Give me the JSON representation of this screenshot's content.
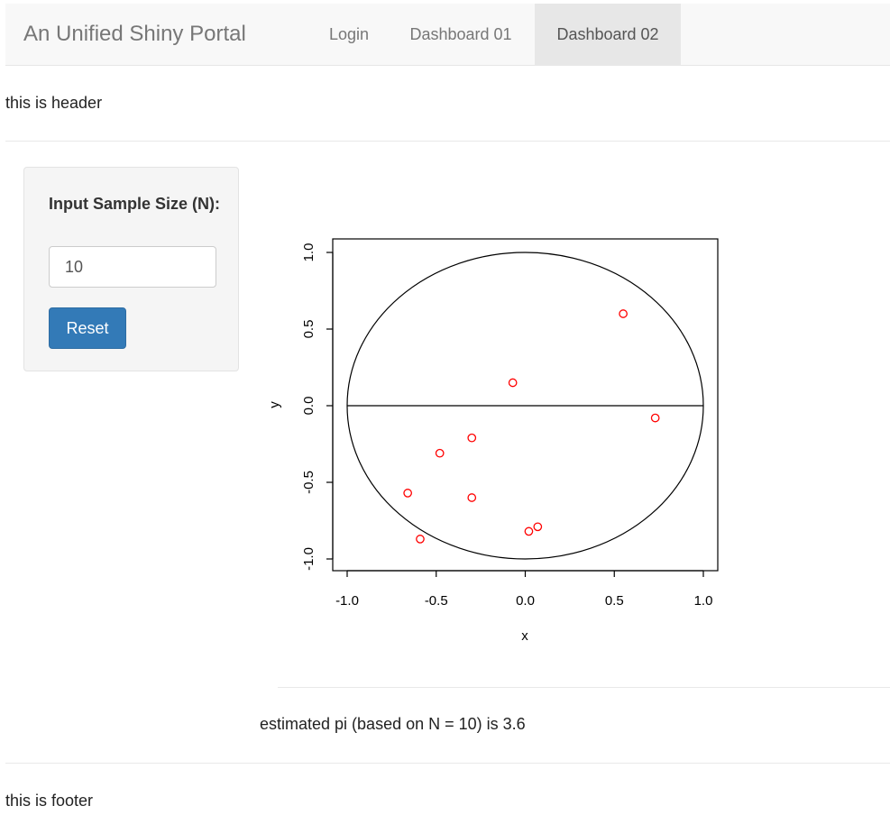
{
  "navbar": {
    "brand": "An Unified Shiny Portal",
    "items": [
      {
        "label": "Login",
        "active": false
      },
      {
        "label": "Dashboard 01",
        "active": false
      },
      {
        "label": "Dashboard 02",
        "active": true
      }
    ]
  },
  "header": {
    "text": "this is header"
  },
  "sidebar": {
    "input_label": "Input Sample Size (N):",
    "input_value": "10",
    "reset_label": "Reset"
  },
  "result": {
    "text": "estimated pi (based on N = 10) is 3.6"
  },
  "footer": {
    "text": "this is footer"
  },
  "colors": {
    "point": "#ff0000",
    "reset_button": "#337ab7",
    "navbar_bg": "#f8f8f8",
    "active_tab_bg": "#e7e7e7"
  },
  "chart_data": {
    "type": "scatter",
    "xlabel": "x",
    "ylabel": "y",
    "xlim": [
      -1.0,
      1.0
    ],
    "ylim": [
      -1.0,
      1.0
    ],
    "xticks": [
      "-1.0",
      "-0.5",
      "0.0",
      "0.5",
      "1.0"
    ],
    "yticks": [
      "-1.0",
      "-0.5",
      "0.0",
      "0.5",
      "1.0"
    ],
    "grid": false,
    "overlays": [
      "unit circle",
      "horizontal line at y = 0"
    ],
    "points": [
      {
        "x": 0.55,
        "y": 0.6
      },
      {
        "x": -0.07,
        "y": 0.15
      },
      {
        "x": 0.73,
        "y": -0.08
      },
      {
        "x": -0.3,
        "y": -0.21
      },
      {
        "x": -0.48,
        "y": -0.31
      },
      {
        "x": -0.66,
        "y": -0.57
      },
      {
        "x": -0.3,
        "y": -0.6
      },
      {
        "x": 0.07,
        "y": -0.79
      },
      {
        "x": 0.02,
        "y": -0.82
      },
      {
        "x": -0.59,
        "y": -0.87
      }
    ]
  }
}
